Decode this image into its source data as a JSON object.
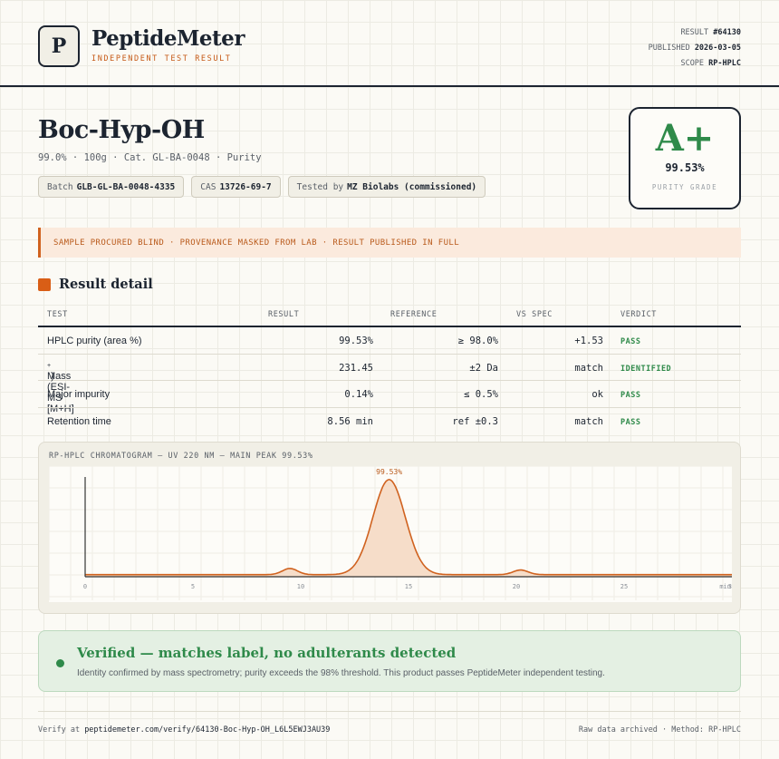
{
  "header": {
    "logo_letter": "P",
    "brand": "PeptideMeter",
    "tagline": "INDEPENDENT TEST RESULT",
    "meta": [
      {
        "label": "RESULT",
        "value": "#64130"
      },
      {
        "label": "PUBLISHED",
        "value": "2026-03-05"
      },
      {
        "label": "SCOPE",
        "value": "RP-HPLC"
      }
    ]
  },
  "product": {
    "title": "Boc-Hyp-OH",
    "subtitle": "99.0% · 100g · Cat. GL-BA-0048 · Purity",
    "chips": [
      {
        "label": "Batch",
        "value": "GLB-GL-BA-0048-4335"
      },
      {
        "label": "CAS",
        "value": "13726-69-7"
      },
      {
        "label": "Tested by",
        "value": "MZ Biolabs (commissioned)"
      }
    ]
  },
  "grade": {
    "letter": "A+",
    "value": "99.53%",
    "caption": "PURITY GRADE",
    "color": "#2f8a4a"
  },
  "notice": "SAMPLE PROCURED BLIND · PROVENANCE MASKED FROM LAB · RESULT PUBLISHED IN FULL",
  "section": {
    "title": "Result detail",
    "accent": "#d95e16"
  },
  "table": {
    "headers": {
      "test": "TEST",
      "result": "RESULT",
      "reference": "REFERENCE",
      "vs_spec": "VS SPEC",
      "verdict": "VERDICT"
    },
    "rows": [
      {
        "test": "HPLC purity (area %)",
        "test_sup": "",
        "result": "99.53%",
        "reference": "≥ 98.0%",
        "vs_spec": "+1.53",
        "verdict": "PASS"
      },
      {
        "test": "Mass (ESI-MS [M+H]",
        "test_sup": "+",
        "test_end": ")",
        "result": "231.45",
        "reference": "±2 Da",
        "vs_spec": "match",
        "verdict": "IDENTIFIED"
      },
      {
        "test": "Major impurity",
        "test_sup": "",
        "result": "0.14%",
        "reference": "≤ 0.5%",
        "vs_spec": "ok",
        "verdict": "PASS"
      },
      {
        "test": "Retention time",
        "test_sup": "",
        "result": "8.56 min",
        "reference": "ref ±0.3",
        "vs_spec": "match",
        "verdict": "PASS"
      }
    ]
  },
  "chart_data": {
    "type": "line",
    "title": "RP-HPLC CHROMATOGRAM — UV 220 NM — MAIN PEAK 99.53%",
    "xlabel": "",
    "ylabel": "",
    "xlim": [
      0,
      30
    ],
    "x_ticks": [
      "0",
      "5",
      "10",
      "15",
      "20",
      "25",
      "30"
    ],
    "x_tick_suffix": "min",
    "line_color": "#d0621f",
    "fill_color": "#f6ddc9",
    "grid": true,
    "baseline": 0.02,
    "peaks": [
      {
        "center": 9.5,
        "height": 0.06,
        "width": 0.35
      },
      {
        "center": 14.1,
        "height": 0.92,
        "width": 0.75
      },
      {
        "center": 20.2,
        "height": 0.045,
        "width": 0.35
      }
    ],
    "peak_label": "99.53%"
  },
  "verified": {
    "title": "Verified — matches label, no adulterants detected",
    "text": "Identity confirmed by mass spectrometry; purity exceeds the 98% threshold. This product passes PeptideMeter independent testing."
  },
  "footer": {
    "verify_label": "Verify at",
    "verify_url": "peptidemeter.com/verify/64130-Boc-Hyp-OH_L6L5EWJ3AU39",
    "right": "Raw data archived · Method: RP-HPLC"
  }
}
